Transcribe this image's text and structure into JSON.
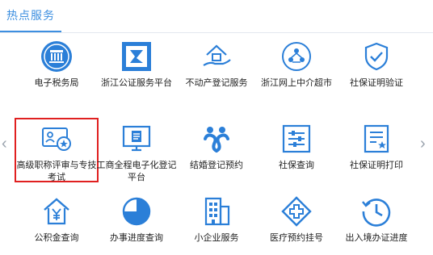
{
  "header": {
    "title": "热点服务"
  },
  "nav": {
    "prev": "‹",
    "next": "›"
  },
  "accent": "#3d8fe0",
  "highlight_color": "#e02020",
  "rows": [
    [
      {
        "label": "电子税务局",
        "icon": "tax-emblem-icon"
      },
      {
        "label": "浙江公证服务平台",
        "icon": "notary-seal-icon"
      },
      {
        "label": "不动产登记服务",
        "icon": "house-hand-icon"
      },
      {
        "label": "浙江网上中介超市",
        "icon": "people-network-icon"
      },
      {
        "label": "社保证明验证",
        "icon": "shield-check-icon"
      }
    ],
    [
      {
        "label": "高级职称评审与专技考试",
        "icon": "id-card-award-icon",
        "highlighted": true
      },
      {
        "label": "工商全程电子化登记平台",
        "icon": "monitor-document-icon"
      },
      {
        "label": "结婚登记预约",
        "icon": "couple-rings-icon"
      },
      {
        "label": "社保查询",
        "icon": "sliders-panel-icon"
      },
      {
        "label": "社保证明打印",
        "icon": "document-star-icon"
      }
    ],
    [
      {
        "label": "公积金查询",
        "icon": "house-yuan-icon"
      },
      {
        "label": "办事进度查询",
        "icon": "pie-progress-icon"
      },
      {
        "label": "小企业服务",
        "icon": "building-icon"
      },
      {
        "label": "医疗预约挂号",
        "icon": "medical-cross-icon"
      },
      {
        "label": "出入境办证进度",
        "icon": "clock-arrow-icon"
      }
    ]
  ]
}
